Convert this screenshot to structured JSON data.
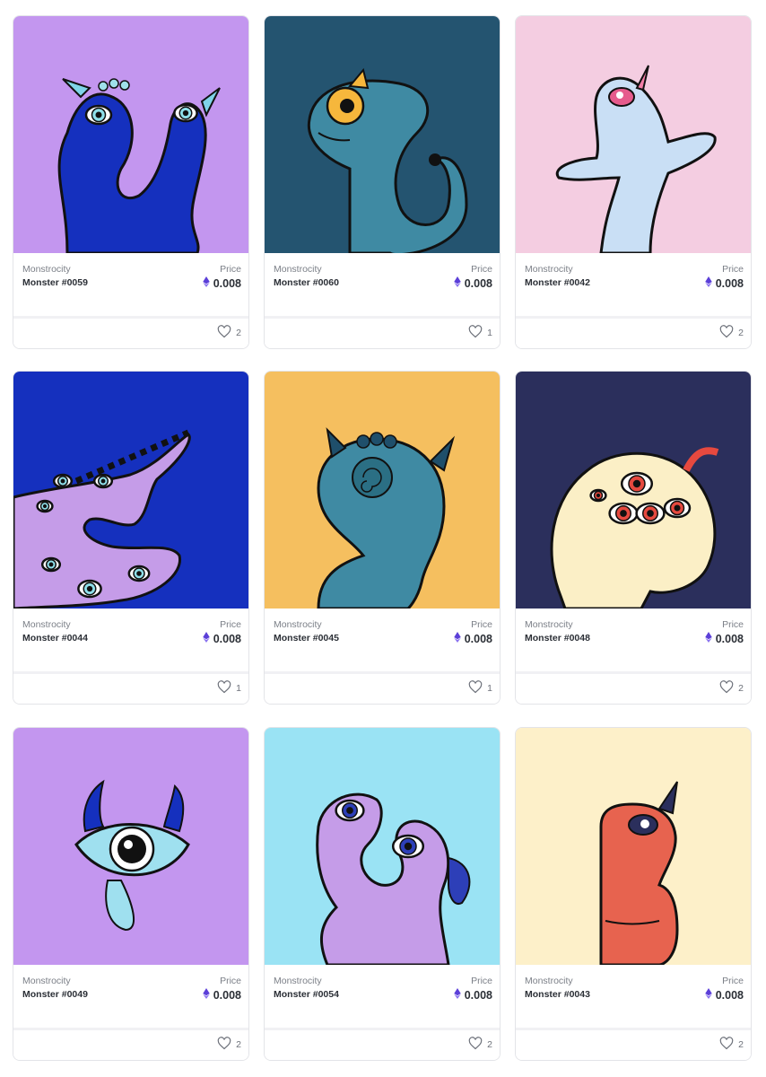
{
  "currency_icon": "ethereum-icon",
  "like_icon": "heart-outline-icon",
  "cards": [
    {
      "collection": "Monstrocity",
      "name": "Monster #0059",
      "price_label": "Price",
      "price": "0.008",
      "likes": "2",
      "bg": "#c396ef",
      "body": "#1530be",
      "art": "double-head-monster-illustration"
    },
    {
      "collection": "Monstrocity",
      "name": "Monster #0060",
      "price_label": "Price",
      "price": "0.008",
      "likes": "1",
      "bg": "#245470",
      "body": "#3f8aa3",
      "art": "yellow-eye-monster-illustration"
    },
    {
      "collection": "Monstrocity",
      "name": "Monster #0042",
      "price_label": "Price",
      "price": "0.008",
      "likes": "2",
      "bg": "#f4cde1",
      "body": "#c9dff5",
      "art": "unicorn-monster-illustration"
    },
    {
      "collection": "Monstrocity",
      "name": "Monster #0044",
      "price_label": "Price",
      "price": "0.008",
      "likes": "1",
      "bg": "#1530be",
      "body": "#c59ce8",
      "art": "many-eyes-monster-illustration"
    },
    {
      "collection": "Monstrocity",
      "name": "Monster #0045",
      "price_label": "Price",
      "price": "0.008",
      "likes": "1",
      "bg": "#f5bf5f",
      "body": "#3f8aa3",
      "art": "spiral-eye-monster-illustration"
    },
    {
      "collection": "Monstrocity",
      "name": "Monster #0048",
      "price_label": "Price",
      "price": "0.008",
      "likes": "2",
      "bg": "#2b2f5c",
      "body": "#fbefc6",
      "art": "red-eyes-monster-illustration"
    },
    {
      "collection": "Monstrocity",
      "name": "Monster #0049",
      "price_label": "Price",
      "price": "0.008",
      "likes": "2",
      "bg": "#c396ef",
      "body": "#9fe0ef",
      "art": "cyclops-eye-monster-illustration"
    },
    {
      "collection": "Monstrocity",
      "name": "Monster #0054",
      "price_label": "Price",
      "price": "0.008",
      "likes": "2",
      "bg": "#9ae3f4",
      "body": "#c59ce8",
      "art": "two-head-purple-monster-illustration"
    },
    {
      "collection": "Monstrocity",
      "name": "Monster #0043",
      "price_label": "Price",
      "price": "0.008",
      "likes": "2",
      "bg": "#fdf0c9",
      "body": "#e7634f",
      "art": "red-horned-monster-illustration"
    }
  ]
}
